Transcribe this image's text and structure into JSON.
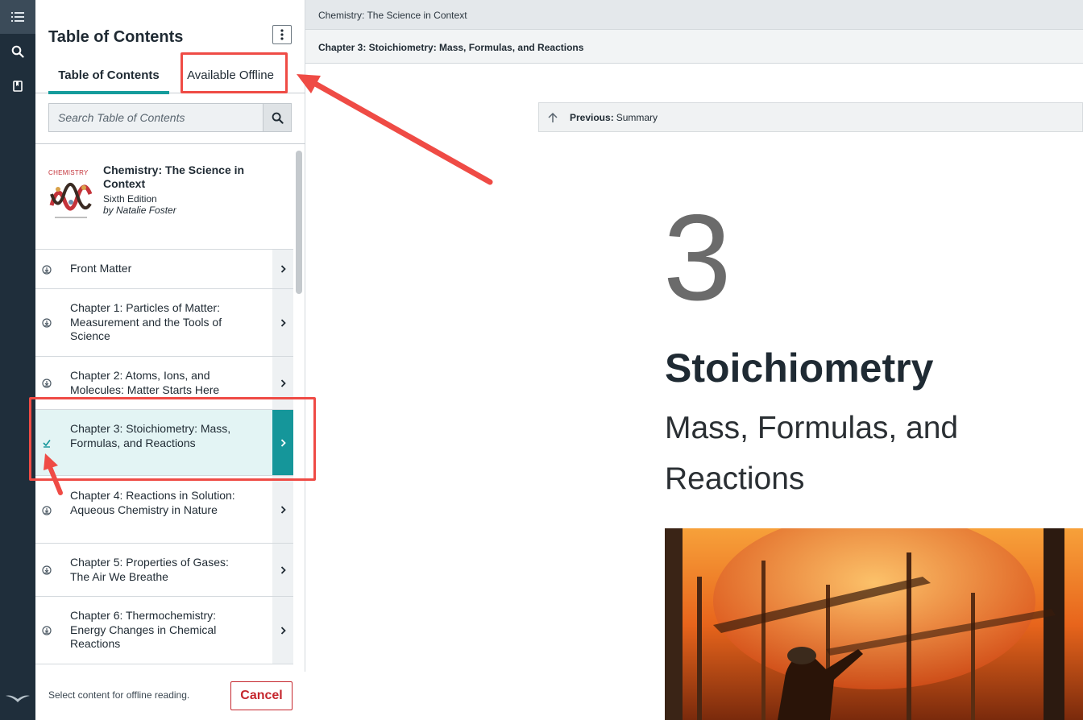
{
  "rail": {
    "items": [
      {
        "name": "toc-list-icon",
        "active": true
      },
      {
        "name": "search-icon",
        "active": false
      },
      {
        "name": "bookmark-icon",
        "active": false
      }
    ],
    "logo": "bird-logo-icon"
  },
  "panel": {
    "title": "Table of Contents",
    "tabs": [
      {
        "label": "Table of Contents",
        "selected": true
      },
      {
        "label": "Available Offline",
        "selected": false
      }
    ],
    "search": {
      "placeholder": "Search Table of Contents",
      "value": ""
    },
    "book": {
      "cover_text": "CHEMISTRY",
      "title": "Chemistry: The Science in Context",
      "edition": "Sixth Edition",
      "author": "by Natalie Foster"
    },
    "items": [
      {
        "label": "Front Matter",
        "status": "download"
      },
      {
        "label": "Chapter 1: Particles of Matter: Measurement and the Tools of Science",
        "status": "download"
      },
      {
        "label": "Chapter 2: Atoms, Ions, and Molecules: Matter Starts Here",
        "status": "download"
      },
      {
        "label": "Chapter 3: Stoichiometry: Mass, Formulas, and Reactions",
        "status": "downloaded"
      },
      {
        "label": "Chapter 4: Reactions in Solution: Aqueous Chemistry in Nature",
        "status": "download"
      },
      {
        "label": "Chapter 5: Properties of Gases: The Air We Breathe",
        "status": "download"
      },
      {
        "label": "Chapter 6: Thermochemistry: Energy Changes in Chemical Reactions",
        "status": "download"
      }
    ],
    "footer": {
      "text": "Select content for offline reading.",
      "cancel_label": "Cancel"
    }
  },
  "main": {
    "breadcrumb_book": "Chemistry: The Science in Context",
    "breadcrumb_chapter": "Chapter 3: Stoichiometry: Mass, Formulas, and Reactions",
    "previous": {
      "label": "Previous:",
      "target": "Summary"
    },
    "chapter": {
      "number": "3",
      "title": "Stoichiometry",
      "subtitle": "Mass, Formulas, and Reactions"
    }
  },
  "colors": {
    "accent": "#15969a",
    "rail": "#1f2e3b",
    "annotation": "#ef4b45",
    "cancel": "#c5262d"
  }
}
